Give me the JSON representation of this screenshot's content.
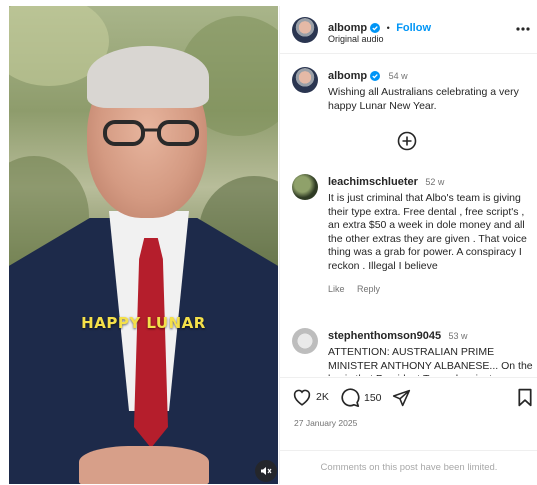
{
  "video": {
    "caption_overlay": "HAPPY LUNAR"
  },
  "header": {
    "username": "albomp",
    "separator": "•",
    "follow_label": "Follow",
    "audio": "Original audio",
    "more_icon": "more-horizontal-icon"
  },
  "post_caption": {
    "username": "albomp",
    "time": "54 w",
    "text": "Wishing all Australians celebrating a very happy Lunar New Year."
  },
  "comments": [
    {
      "username": "leachimschlueter",
      "time": "52 w",
      "text": "It is just criminal that Albo's team is giving their type extra. Free dental , free script's , an extra $50 a week in dole money and all the other extras they are given . That voice thing was a grab for power. A conspiracy I reckon . Illegal I believe",
      "like_label": "Like",
      "reply_label": "Reply"
    },
    {
      "username": "stephenthomson9045",
      "time": "53 w",
      "text": "ATTENTION: AUSTRALIAN PRIME MINISTER ANTHONY ALBANESE... On the basis that President Trump has just"
    }
  ],
  "actions": {
    "likes": "2K",
    "comments": "150",
    "date": "27 January 2025"
  },
  "footer": {
    "limited_text": "Comments on this post have been limited."
  },
  "colors": {
    "accent": "#0095f6",
    "verified": "#0095f6",
    "caption_overlay": "#f4e04a"
  }
}
